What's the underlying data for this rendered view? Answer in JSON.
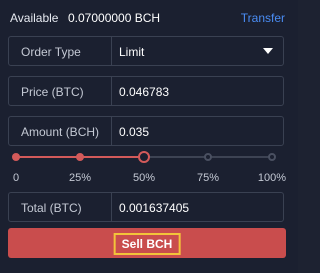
{
  "available": {
    "label": "Available",
    "value": "0.07000000 BCH",
    "transfer_label": "Transfer"
  },
  "order_type": {
    "label": "Order Type",
    "value": "Limit"
  },
  "price": {
    "label": "Price (BTC)",
    "value": "0.046783"
  },
  "amount": {
    "label": "Amount (BCH)",
    "value": "0.035"
  },
  "slider": {
    "value_percent": 50,
    "marks": [
      0,
      25,
      50,
      75,
      100
    ],
    "tick_labels": [
      "0",
      "25%",
      "50%",
      "75%",
      "100%"
    ]
  },
  "total": {
    "label": "Total (BTC)",
    "value": "0.001637405"
  },
  "sell_button": {
    "label": "Sell BCH"
  },
  "colors": {
    "accent_sell": "#c94d4d",
    "link": "#4a8cf3",
    "highlight_border": "#f3c43a"
  }
}
